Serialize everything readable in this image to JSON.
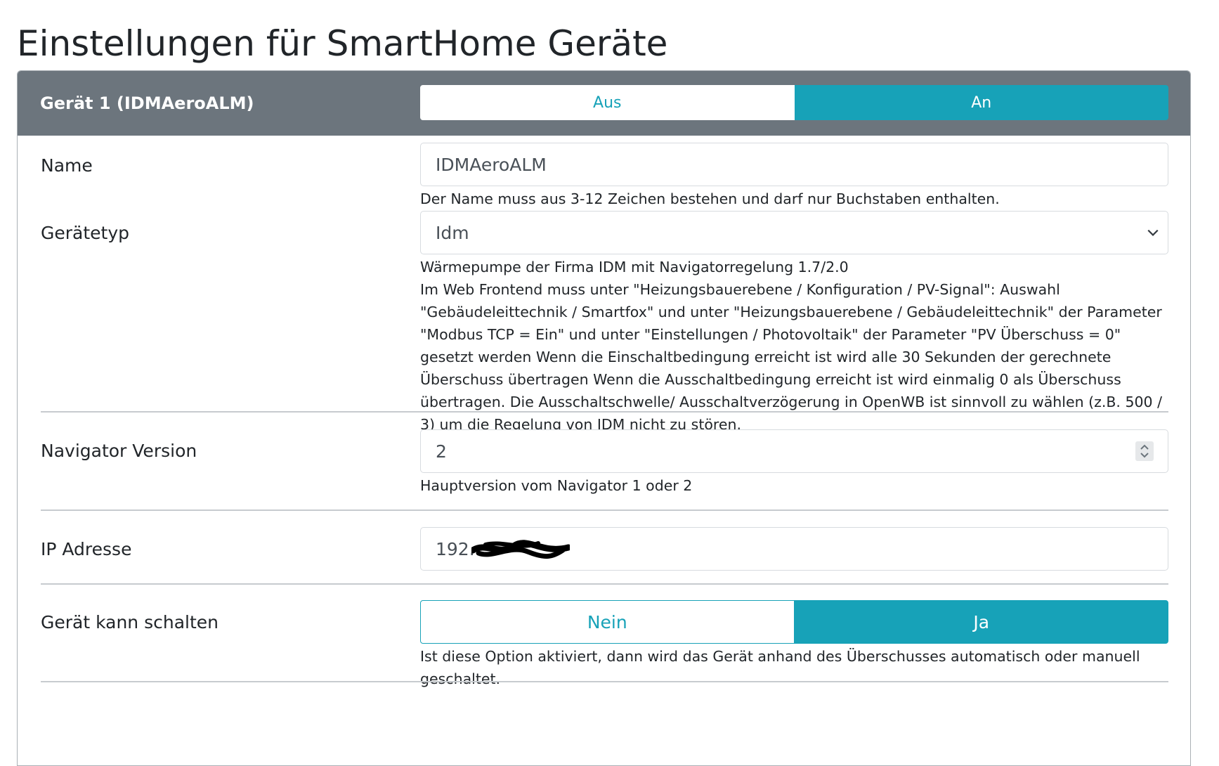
{
  "page": {
    "title": "Einstellungen für SmartHome Geräte"
  },
  "device": {
    "header_title": "Gerät 1 (IDMAeroALM)",
    "power_toggle": {
      "off_label": "Aus",
      "on_label": "An",
      "selected": "An"
    },
    "name": {
      "label": "Name",
      "value": "IDMAeroALM",
      "help": "Der Name muss aus 3-12 Zeichen bestehen und darf nur Buchstaben enthalten."
    },
    "type": {
      "label": "Gerätetyp",
      "value": "Idm",
      "help_title": "Wärmepumpe der Firma IDM mit Navigatorregelung 1.7/2.0",
      "help_body": "Im Web Frontend muss unter \"Heizungsbauerebene / Konfiguration / PV-Signal\": Auswahl \"Gebäudeleittechnik / Smartfox\" und unter \"Heizungsbauerebene / Gebäudeleittechnik\" der Parameter \"Modbus TCP = Ein\" und unter \"Einstellungen / Photovoltaik\" der Parameter \"PV Überschuss = 0\" gesetzt werden Wenn die Einschaltbedingung erreicht ist wird alle 30 Sekunden der gerechnete Überschuss übertragen Wenn die Ausschaltbedingung erreicht ist wird einmalig 0 als Überschuss übertragen. Die Ausschaltschwelle/ Ausschaltverzögerung in OpenWB ist sinnvoll zu wählen (z.B. 500 / 3) um die Regelung von IDM nicht zu stören."
    },
    "navigator": {
      "label": "Navigator Version",
      "value": "2",
      "help": "Hauptversion vom Navigator 1 oder 2"
    },
    "ip": {
      "label": "IP Adresse",
      "value_prefix": "192."
    },
    "can_switch": {
      "label": "Gerät kann schalten",
      "no_label": "Nein",
      "yes_label": "Ja",
      "selected": "Ja",
      "help": "Ist diese Option aktiviert, dann wird das Gerät anhand des Überschusses automatisch oder manuell geschaltet."
    }
  },
  "colors": {
    "header_bg": "#6c757d",
    "accent": "#17a2b8"
  }
}
